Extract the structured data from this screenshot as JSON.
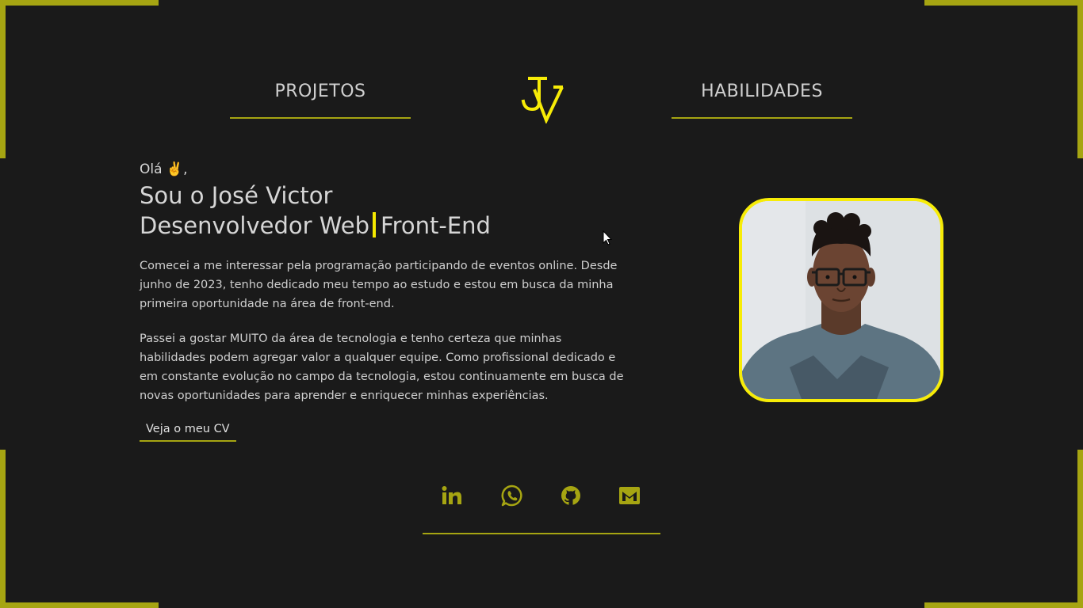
{
  "nav": {
    "projects_label": "PROJETOS",
    "skills_label": "HABILIDADES"
  },
  "hero": {
    "greeting": "Olá ✌️,",
    "name_line": "Sou o José Victor",
    "role_main": "Desenvolvedor Web",
    "role_sub": "Front-End",
    "paragraph_1": "Comecei a me interessar pela programação participando de eventos online. Desde junho de 2023, tenho dedicado meu tempo ao estudo e estou em busca da minha primeira oportunidade na área de front-end.",
    "paragraph_2": "Passei a gostar MUITO da área de tecnologia e tenho certeza que minhas habilidades podem agregar valor a qualquer equipe. Como profissional dedicado e em constante evolução no campo da tecnologia, estou continuamente em busca de novas oportunidades para aprender e enriquecer minhas experiências.",
    "cv_label": "Veja o meu CV"
  },
  "socials": [
    {
      "icon": "linkedin-icon"
    },
    {
      "icon": "whatsapp-icon"
    },
    {
      "icon": "github-icon"
    },
    {
      "icon": "mail-icon"
    }
  ],
  "colors": {
    "background": "#1a1a1a",
    "accent": "#a6a512",
    "highlight": "#f7ec07",
    "text": "#d6d6d6"
  }
}
